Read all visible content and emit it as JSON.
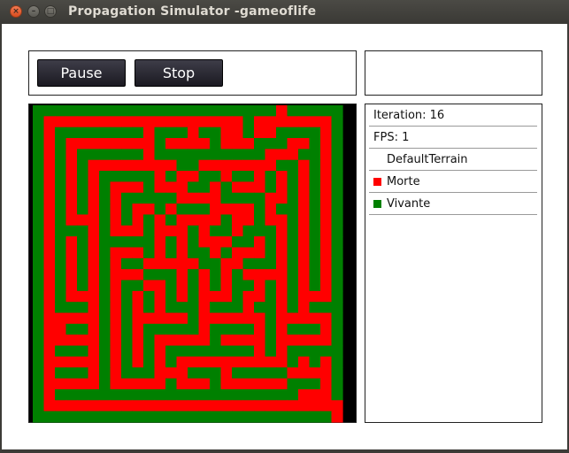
{
  "window": {
    "title": "Propagation Simulator -gameoflife",
    "close_glyph": "×",
    "minimize_glyph": "–",
    "maximize_glyph": "□"
  },
  "controls": {
    "pause_label": "Pause",
    "stop_label": "Stop"
  },
  "info": {
    "iteration_label": "Iteration: 16",
    "fps_label": "FPS: 1",
    "terrain_label": "DefaultTerrain",
    "states": [
      {
        "label": "Morte",
        "color": "#ff0000"
      },
      {
        "label": "Vivante",
        "color": "#008000"
      }
    ]
  },
  "grid": {
    "cols": 28,
    "rows": 29,
    "colors": {
      "0": "#ff0000",
      "1": "#008000"
    },
    "cells": [
      "1111111111111111111111011111",
      "1000000000000000000100000001",
      "1011111111011101100100111101",
      "1010000000010000100011100101",
      "1010111111011111111110001101",
      "1010100000000110000000110101",
      "1010101111101001101101010101",
      "1010101000100011010001010101",
      "1010101011111000011110010101",
      "1010101010010111000010110101",
      "1010001010101000010010010101",
      "1011101000100010110111010101",
      "1010101111101010001101010101",
      "1010101000101011010001010101",
      "1010101011000001100111010101",
      "1010101000111010101000010101",
      "1010101011001010101101010101",
      "1010001010101010001001010001",
      "1011101010101110111011010111",
      "1000001010000010000001000001",
      "1001101010111110111101011101",
      "1000001010100000100001000001",
      "1011101010101111111101011111",
      "1000001010101000000000010101",
      "1011101011100011101111100001",
      "1000001000001000100000011101",
      "1011111111111111111111110001",
      "1000000000000000000000000000",
      "1111111111111111111111111110"
    ]
  }
}
